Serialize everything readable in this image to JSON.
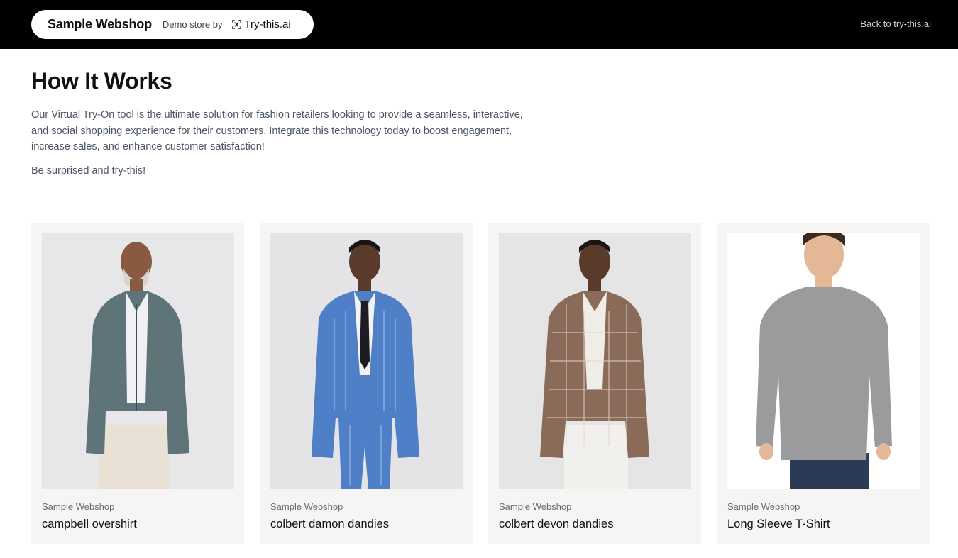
{
  "header": {
    "brand": "Sample Webshop",
    "demo_label": "Demo store by",
    "partner_logo_icon": "try-this-logo-icon",
    "partner_name": "Try-this.ai",
    "back_link": "Back to try-this.ai"
  },
  "main": {
    "title": "How It Works",
    "intro": "Our Virtual Try-On tool is the ultimate solution for fashion retailers looking to provide a seamless, interactive, and social shopping experience for their customers. Integrate this technology today to boost engagement, increase sales, and enhance customer satisfaction!",
    "tagline": "Be surprised and try-this!"
  },
  "products": [
    {
      "vendor": "Sample Webshop",
      "name": "campbell overshirt",
      "garment_color": "#5e7478"
    },
    {
      "vendor": "Sample Webshop",
      "name": "colbert damon dandies",
      "garment_color": "#4f7fc6"
    },
    {
      "vendor": "Sample Webshop",
      "name": "colbert devon dandies",
      "garment_color": "#8a6a58"
    },
    {
      "vendor": "Sample Webshop",
      "name": "Long Sleeve T-Shirt",
      "garment_color": "#9b9a9c"
    }
  ],
  "colors": {
    "header_bg": "#000000",
    "card_bg": "#f6f5f3",
    "body_text": "#4b5563"
  }
}
